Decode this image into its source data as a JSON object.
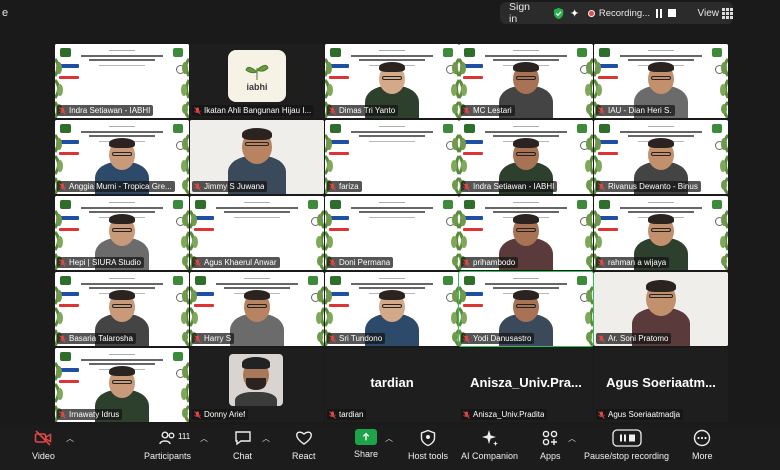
{
  "app": {
    "title_fragment": "e"
  },
  "topbar": {
    "sign_in": "Sign in",
    "recording": "Recording...",
    "view": "View"
  },
  "participants": [
    {
      "name": "Indra Setiawan - IABHI",
      "kind": "slide"
    },
    {
      "name": "Ikatan Ahli Bangunan Hijau I...",
      "kind": "logo"
    },
    {
      "name": "Dimas Tri Yanto",
      "kind": "slide-person"
    },
    {
      "name": "MC Lestari",
      "kind": "slide-person"
    },
    {
      "name": "IAU - Dian Heri S.",
      "kind": "slide-person"
    },
    {
      "name": "Anggia Murni - Tropica Gre...",
      "kind": "slide-person"
    },
    {
      "name": "Jimmy S Juwana",
      "kind": "person"
    },
    {
      "name": "fariza",
      "kind": "slide"
    },
    {
      "name": "Indra Setiawan - IABHI",
      "kind": "slide-person"
    },
    {
      "name": "Rivanus Dewanto - Binus",
      "kind": "slide-person"
    },
    {
      "name": "Hepi | SIURA Studio",
      "kind": "slide-person"
    },
    {
      "name": "Agus Khaerul Anwar",
      "kind": "slide"
    },
    {
      "name": "Doni Permana",
      "kind": "slide"
    },
    {
      "name": "prihambodo",
      "kind": "slide-person"
    },
    {
      "name": "rahman a wijaya",
      "kind": "slide-person"
    },
    {
      "name": "Basaria Talarosha",
      "kind": "slide-person"
    },
    {
      "name": "Harry S",
      "kind": "slide-person"
    },
    {
      "name": "Sri Tundono",
      "kind": "slide-person"
    },
    {
      "name": "Yodi Danusastro",
      "kind": "slide-person"
    },
    {
      "name": "Ar. Soni Pratomo",
      "kind": "person"
    },
    {
      "name": "Irnawaty Idrus",
      "kind": "slide-person"
    },
    {
      "name": "Donny Arief",
      "kind": "avatar"
    },
    {
      "name": "tardian",
      "kind": "name",
      "big": "tardian"
    },
    {
      "name": "Anisza_Univ.Pradita",
      "kind": "name",
      "big": "Anisza_Univ.Pra..."
    },
    {
      "name": "Agus Soeriaatmadja",
      "kind": "name",
      "big": "Agus  Soeriaatm..."
    }
  ],
  "logo_text": "iabhi",
  "toolbar": {
    "video": "Video",
    "participants": "Participants",
    "participant_count": "111",
    "chat": "Chat",
    "react": "React",
    "share": "Share",
    "host_tools": "Host tools",
    "ai_companion": "AI Companion",
    "apps": "Apps",
    "pause_stop": "Pause/stop recording",
    "more": "More"
  },
  "colors": {
    "speaking_border": "#2fbf5b",
    "share_green": "#1fa34a",
    "muted_red": "#e04848",
    "recording_red": "#e64a45"
  }
}
